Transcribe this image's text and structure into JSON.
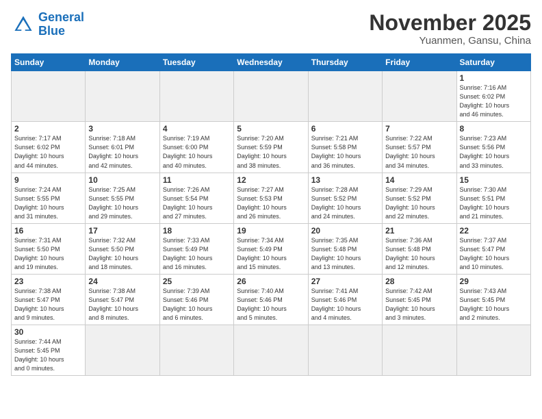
{
  "header": {
    "logo_general": "General",
    "logo_blue": "Blue",
    "month": "November 2025",
    "location": "Yuanmen, Gansu, China"
  },
  "weekdays": [
    "Sunday",
    "Monday",
    "Tuesday",
    "Wednesday",
    "Thursday",
    "Friday",
    "Saturday"
  ],
  "days": {
    "d1": {
      "num": "1",
      "info": "Sunrise: 7:16 AM\nSunset: 6:02 PM\nDaylight: 10 hours\nand 46 minutes."
    },
    "d2": {
      "num": "2",
      "info": "Sunrise: 7:17 AM\nSunset: 6:02 PM\nDaylight: 10 hours\nand 44 minutes."
    },
    "d3": {
      "num": "3",
      "info": "Sunrise: 7:18 AM\nSunset: 6:01 PM\nDaylight: 10 hours\nand 42 minutes."
    },
    "d4": {
      "num": "4",
      "info": "Sunrise: 7:19 AM\nSunset: 6:00 PM\nDaylight: 10 hours\nand 40 minutes."
    },
    "d5": {
      "num": "5",
      "info": "Sunrise: 7:20 AM\nSunset: 5:59 PM\nDaylight: 10 hours\nand 38 minutes."
    },
    "d6": {
      "num": "6",
      "info": "Sunrise: 7:21 AM\nSunset: 5:58 PM\nDaylight: 10 hours\nand 36 minutes."
    },
    "d7": {
      "num": "7",
      "info": "Sunrise: 7:22 AM\nSunset: 5:57 PM\nDaylight: 10 hours\nand 34 minutes."
    },
    "d8": {
      "num": "8",
      "info": "Sunrise: 7:23 AM\nSunset: 5:56 PM\nDaylight: 10 hours\nand 33 minutes."
    },
    "d9": {
      "num": "9",
      "info": "Sunrise: 7:24 AM\nSunset: 5:55 PM\nDaylight: 10 hours\nand 31 minutes."
    },
    "d10": {
      "num": "10",
      "info": "Sunrise: 7:25 AM\nSunset: 5:55 PM\nDaylight: 10 hours\nand 29 minutes."
    },
    "d11": {
      "num": "11",
      "info": "Sunrise: 7:26 AM\nSunset: 5:54 PM\nDaylight: 10 hours\nand 27 minutes."
    },
    "d12": {
      "num": "12",
      "info": "Sunrise: 7:27 AM\nSunset: 5:53 PM\nDaylight: 10 hours\nand 26 minutes."
    },
    "d13": {
      "num": "13",
      "info": "Sunrise: 7:28 AM\nSunset: 5:52 PM\nDaylight: 10 hours\nand 24 minutes."
    },
    "d14": {
      "num": "14",
      "info": "Sunrise: 7:29 AM\nSunset: 5:52 PM\nDaylight: 10 hours\nand 22 minutes."
    },
    "d15": {
      "num": "15",
      "info": "Sunrise: 7:30 AM\nSunset: 5:51 PM\nDaylight: 10 hours\nand 21 minutes."
    },
    "d16": {
      "num": "16",
      "info": "Sunrise: 7:31 AM\nSunset: 5:50 PM\nDaylight: 10 hours\nand 19 minutes."
    },
    "d17": {
      "num": "17",
      "info": "Sunrise: 7:32 AM\nSunset: 5:50 PM\nDaylight: 10 hours\nand 18 minutes."
    },
    "d18": {
      "num": "18",
      "info": "Sunrise: 7:33 AM\nSunset: 5:49 PM\nDaylight: 10 hours\nand 16 minutes."
    },
    "d19": {
      "num": "19",
      "info": "Sunrise: 7:34 AM\nSunset: 5:49 PM\nDaylight: 10 hours\nand 15 minutes."
    },
    "d20": {
      "num": "20",
      "info": "Sunrise: 7:35 AM\nSunset: 5:48 PM\nDaylight: 10 hours\nand 13 minutes."
    },
    "d21": {
      "num": "21",
      "info": "Sunrise: 7:36 AM\nSunset: 5:48 PM\nDaylight: 10 hours\nand 12 minutes."
    },
    "d22": {
      "num": "22",
      "info": "Sunrise: 7:37 AM\nSunset: 5:47 PM\nDaylight: 10 hours\nand 10 minutes."
    },
    "d23": {
      "num": "23",
      "info": "Sunrise: 7:38 AM\nSunset: 5:47 PM\nDaylight: 10 hours\nand 9 minutes."
    },
    "d24": {
      "num": "24",
      "info": "Sunrise: 7:38 AM\nSunset: 5:47 PM\nDaylight: 10 hours\nand 8 minutes."
    },
    "d25": {
      "num": "25",
      "info": "Sunrise: 7:39 AM\nSunset: 5:46 PM\nDaylight: 10 hours\nand 6 minutes."
    },
    "d26": {
      "num": "26",
      "info": "Sunrise: 7:40 AM\nSunset: 5:46 PM\nDaylight: 10 hours\nand 5 minutes."
    },
    "d27": {
      "num": "27",
      "info": "Sunrise: 7:41 AM\nSunset: 5:46 PM\nDaylight: 10 hours\nand 4 minutes."
    },
    "d28": {
      "num": "28",
      "info": "Sunrise: 7:42 AM\nSunset: 5:45 PM\nDaylight: 10 hours\nand 3 minutes."
    },
    "d29": {
      "num": "29",
      "info": "Sunrise: 7:43 AM\nSunset: 5:45 PM\nDaylight: 10 hours\nand 2 minutes."
    },
    "d30": {
      "num": "30",
      "info": "Sunrise: 7:44 AM\nSunset: 5:45 PM\nDaylight: 10 hours\nand 0 minutes."
    }
  }
}
